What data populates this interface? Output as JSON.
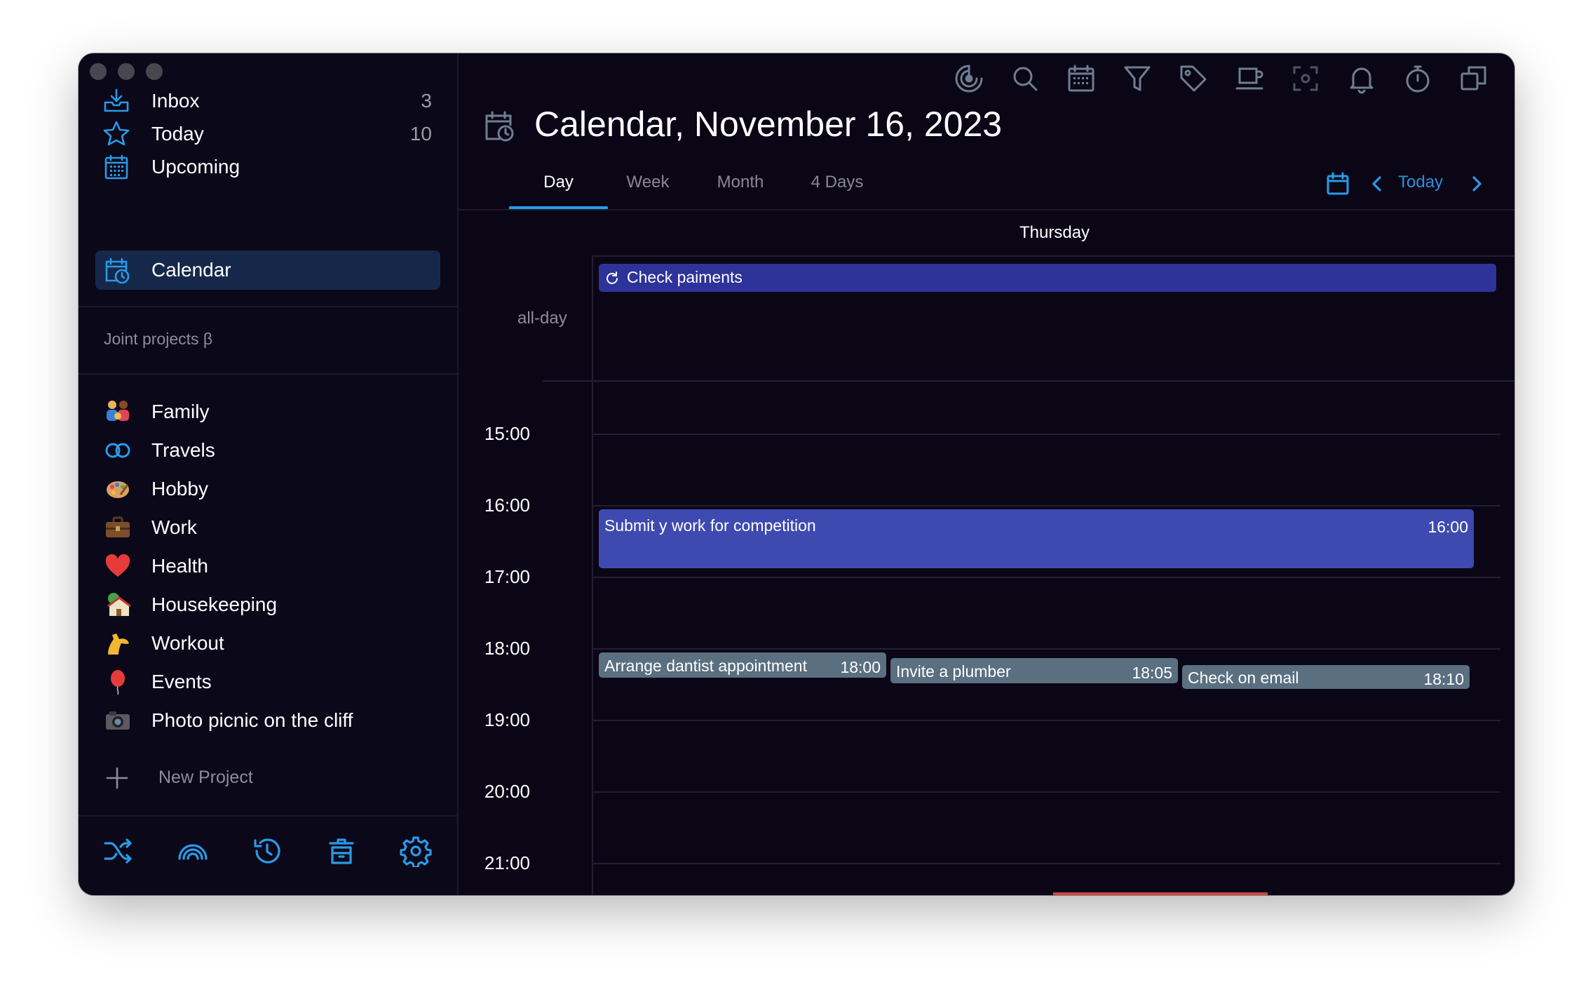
{
  "sidebar": {
    "nav": [
      {
        "label": "Inbox",
        "count": "3",
        "icon": "inbox-icon"
      },
      {
        "label": "Today",
        "count": "10",
        "icon": "star-icon"
      },
      {
        "label": "Upcoming",
        "count": "",
        "icon": "calendar-grid-icon"
      },
      {
        "label": "Calendar",
        "count": "",
        "icon": "calendar-clock-icon"
      }
    ],
    "section_title": "Joint projects β",
    "projects": [
      {
        "label": "Family",
        "icon": "family-emoji-icon"
      },
      {
        "label": "Travels",
        "icon": "infinity-icon"
      },
      {
        "label": "Hobby",
        "icon": "palette-emoji-icon"
      },
      {
        "label": "Work",
        "icon": "briefcase-emoji-icon"
      },
      {
        "label": "Health",
        "icon": "heart-emoji-icon"
      },
      {
        "label": "Housekeeping",
        "icon": "house-emoji-icon"
      },
      {
        "label": "Workout",
        "icon": "flexed-biceps-emoji-icon"
      },
      {
        "label": "Events",
        "icon": "balloon-emoji-icon"
      },
      {
        "label": "Photo picnic on the cliff",
        "icon": "camera-emoji-icon"
      }
    ],
    "new_project_label": "New Project",
    "bottom_icons": [
      "shuffle-icon",
      "rainbow-icon",
      "history-icon",
      "trash-icon",
      "settings-icon"
    ]
  },
  "toolbar": {
    "icons": [
      "focus-icon",
      "search-icon",
      "calendar-icon",
      "filter-icon",
      "tag-icon",
      "coffee-icon",
      "scan-icon",
      "bell-icon",
      "timer-icon",
      "duplicate-icon"
    ]
  },
  "header": {
    "title": "Calendar, November 16, 2023",
    "tabs": [
      "Day",
      "Week",
      "Month",
      "4 Days"
    ],
    "active_tab": "Day",
    "today_label": "Today"
  },
  "calendar": {
    "day_name": "Thursday",
    "allday_label": "all-day",
    "allday_event": "Check paiments",
    "hours": [
      "15:00",
      "16:00",
      "17:00",
      "18:00",
      "19:00",
      "20:00",
      "21:00"
    ],
    "events": [
      {
        "title": "Submit y work for competition",
        "time": "16:00",
        "color": "#3f4ab0"
      },
      {
        "title": "Arrange dantist appointment",
        "time": "18:00",
        "color": "#5a6f80"
      },
      {
        "title": "Invite a plumber",
        "time": "18:05",
        "color": "#5a6f80"
      },
      {
        "title": "Check on email",
        "time": "18:10",
        "color": "#5a6f80"
      }
    ]
  },
  "colors": {
    "accent": "#2a9ae8",
    "window_bg": "#0a0616",
    "active_nav_bg": "#16284a",
    "allday_event": "#2d3399"
  }
}
